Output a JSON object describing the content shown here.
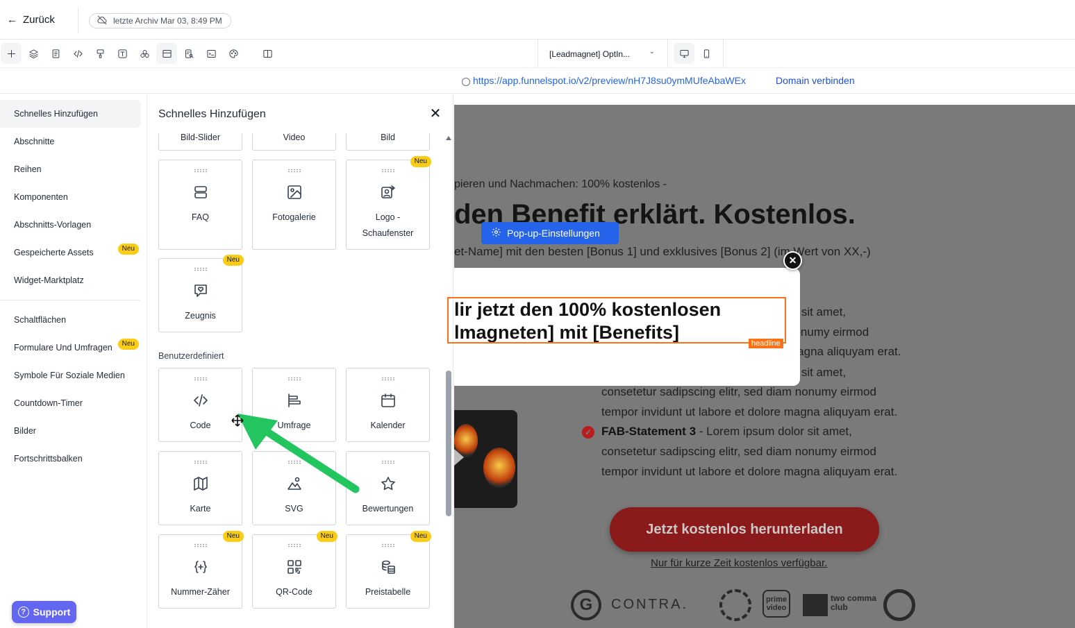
{
  "topbar": {
    "back_label": "Zurück",
    "archive_label": "letzte Archiv Mar 03, 8:49 PM"
  },
  "toolbar": {
    "tools": [
      "plus-icon",
      "layers-icon",
      "page-icon",
      "code-icon",
      "paint-icon",
      "text-icon",
      "components-icon",
      "sections-icon",
      "seo-icon",
      "terminal-icon",
      "palette-icon",
      "split-view-icon"
    ],
    "page_select": "[Leadmagnet] OptIn...",
    "devices": [
      "desktop-icon",
      "mobile-icon"
    ]
  },
  "urlbar": {
    "url": "https://app.funnelspot.io/v2/preview/nH7J8su0ymMUfeAbaWEx",
    "domain_link": "Domain verbinden"
  },
  "leftnav": {
    "items": [
      {
        "label": "Schnelles Hinzufügen",
        "active": true,
        "badge": ""
      },
      {
        "label": "Abschnitte",
        "active": false,
        "badge": ""
      },
      {
        "label": "Reihen",
        "active": false,
        "badge": ""
      },
      {
        "label": "Komponenten",
        "active": false,
        "badge": ""
      },
      {
        "label": "Abschnitts-Vorlagen",
        "active": false,
        "badge": ""
      },
      {
        "label": "Gespeicherte Assets",
        "active": false,
        "badge": "Neu"
      },
      {
        "label": "Widget-Marktplatz",
        "active": false,
        "badge": ""
      }
    ],
    "items2": [
      {
        "label": "Schaltflächen",
        "badge": ""
      },
      {
        "label": "Formulare Und Umfragen",
        "badge": "Neu"
      },
      {
        "label": "Symbole Für Soziale Medien",
        "badge": ""
      },
      {
        "label": "Countdown-Timer",
        "badge": ""
      },
      {
        "label": "Bilder",
        "badge": ""
      },
      {
        "label": "Fortschrittsbalken",
        "badge": ""
      }
    ],
    "support_label": "Support"
  },
  "panel": {
    "title": "Schnelles Hinzufügen",
    "top_row": [
      "Bild-Slider",
      "Video",
      "Bild"
    ],
    "cards_a": [
      {
        "label": "FAQ",
        "icon": "faq-icon",
        "badge": ""
      },
      {
        "label": "Fotogalerie",
        "icon": "gallery-icon",
        "badge": ""
      },
      {
        "label": "Logo - Schaufenster",
        "icon": "logo-showcase-icon",
        "badge": "Neu"
      },
      {
        "label": "Zeugnis",
        "icon": "testimonial-icon",
        "badge": "Neu"
      }
    ],
    "custom_section": "Benutzerdefiniert",
    "cards_b": [
      {
        "label": "Code",
        "icon": "code-icon",
        "badge": ""
      },
      {
        "label": "Umfrage",
        "icon": "survey-icon",
        "badge": ""
      },
      {
        "label": "Kalender",
        "icon": "calendar-icon",
        "badge": ""
      },
      {
        "label": "Karte",
        "icon": "map-icon",
        "badge": ""
      },
      {
        "label": "SVG",
        "icon": "svg-icon",
        "badge": ""
      },
      {
        "label": "Bewertungen",
        "icon": "star-icon",
        "badge": ""
      },
      {
        "label": "Nummer-Zäher",
        "icon": "counter-icon",
        "badge": "Neu"
      },
      {
        "label": "QR-Code",
        "icon": "qr-icon",
        "badge": "Neu"
      },
      {
        "label": "Preistabelle",
        "icon": "pricing-icon",
        "badge": "Neu"
      }
    ]
  },
  "canvas": {
    "pretitle": "pieren und Nachmachen: 100% kostenlos -",
    "headline": "den Benefit erklärt. Kostenlos.",
    "subline": "et-Name] mit den besten [Bonus 1] und exklusives [Bonus 2] (im Wert von XX,-)",
    "fab_tails": [
      "or sit amet,",
      "nonumy eirmod",
      "magna aliquyam erat.",
      "or sit amet,"
    ],
    "fab_lines": [
      "consetetur sadipscing elitr, sed diam nonumy eirmod",
      "tempor invidunt ut labore et dolore magna aliquyam erat."
    ],
    "fab3_title": "FAB-Statement 3",
    "fab3_text": " - Lorem ipsum dolor sit amet,",
    "fab3_lines": [
      "consetetur sadipscing elitr, sed diam nonumy eirmod",
      "tempor invidunt ut labore et dolore magna aliquyam erat."
    ],
    "cta": "Jetzt kostenlos herunterladen",
    "cta_note": "Nur für kurze Zeit kostenlos verfügbar.",
    "logos": [
      "G",
      "CONTRA.",
      "prime video",
      "two comma club"
    ]
  },
  "popup": {
    "settings_label": "Pop-up-Einstellungen",
    "headline_line1": "lir jetzt den 100% kostenlosen",
    "headline_line2": "lmagneten] mit [Benefits]",
    "tag": "headline"
  },
  "colors": {
    "accent": "#2563eb",
    "badge": "#facc15",
    "selection": "#f97316",
    "cta": "#8b1a1a",
    "annotation": "#22c55e",
    "support": "#6366f1"
  }
}
